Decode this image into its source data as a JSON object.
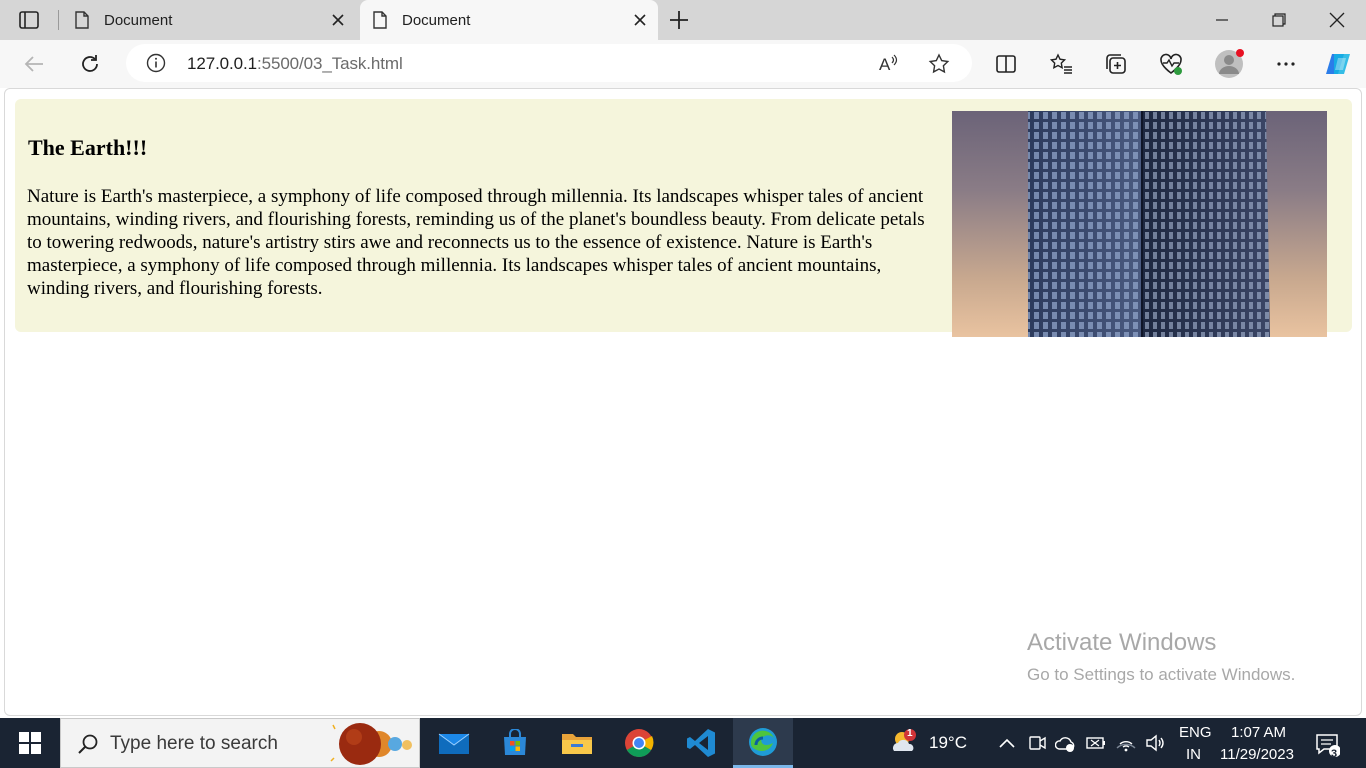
{
  "browser": {
    "tabs": [
      {
        "title": "Document",
        "active": false
      },
      {
        "title": "Document",
        "active": true
      }
    ],
    "url_host": "127.0.0.1",
    "url_path": ":5500/03_Task.html"
  },
  "page": {
    "heading": "The Earth!!!",
    "paragraph": "Nature is Earth's masterpiece, a symphony of life composed through millennia. Its landscapes whisper tales of ancient mountains, winding rivers, and flourishing forests, reminding us of the planet's boundless beauty. From delicate petals to towering redwoods, nature's artistry stirs awe and reconnects us to the essence of existence. Nature is Earth's masterpiece, a symphony of life composed through millennia. Its landscapes whisper tales of ancient mountains, winding rivers, and flourishing forests.",
    "card_background": "#f5f5dc"
  },
  "watermark": {
    "line1": "Activate Windows",
    "line2": "Go to Settings to activate Windows."
  },
  "taskbar": {
    "search_placeholder": "Type here to search",
    "weather_temp": "19°C",
    "weather_badge": "1",
    "language_top": "ENG",
    "language_bottom": "IN",
    "time": "1:07 AM",
    "date": "11/29/2023",
    "notification_count": "3",
    "apps": [
      "mail-icon",
      "store-icon",
      "file-explorer-icon",
      "chrome-icon",
      "vscode-icon",
      "edge-icon"
    ]
  }
}
